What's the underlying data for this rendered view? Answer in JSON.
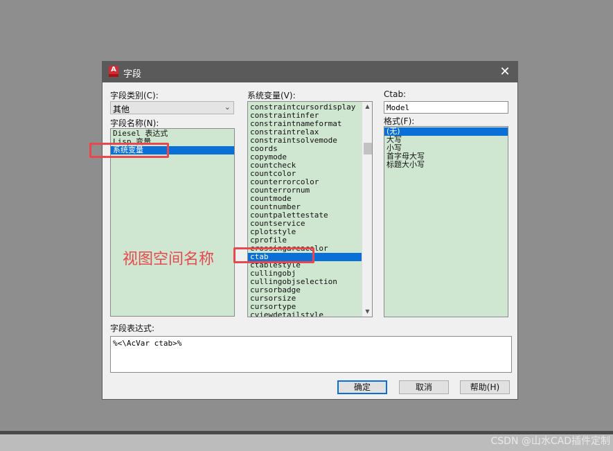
{
  "dialog": {
    "title": "字段",
    "app_icon_letter": "A",
    "close_glyph": "✕",
    "field_category_label": "字段类别(C):",
    "field_category_value": "其他",
    "field_names_label": "字段名称(N):",
    "field_names": [
      {
        "label": "Diesel 表达式",
        "selected": false
      },
      {
        "label": "Lisp 变量",
        "selected": false
      },
      {
        "label": "系统变量",
        "selected": true
      }
    ],
    "system_vars_label": "系统变量(V):",
    "system_vars": [
      {
        "label": "constraintcursordisplay",
        "selected": false
      },
      {
        "label": "constraintinfer",
        "selected": false
      },
      {
        "label": "constraintnameformat",
        "selected": false
      },
      {
        "label": "constraintrelax",
        "selected": false
      },
      {
        "label": "constraintsolvemode",
        "selected": false
      },
      {
        "label": "coords",
        "selected": false
      },
      {
        "label": "copymode",
        "selected": false
      },
      {
        "label": "countcheck",
        "selected": false
      },
      {
        "label": "countcolor",
        "selected": false
      },
      {
        "label": "counterrorcolor",
        "selected": false
      },
      {
        "label": "counterrornum",
        "selected": false
      },
      {
        "label": "countmode",
        "selected": false
      },
      {
        "label": "countnumber",
        "selected": false
      },
      {
        "label": "countpalettestate",
        "selected": false
      },
      {
        "label": "countservice",
        "selected": false
      },
      {
        "label": "cplotstyle",
        "selected": false
      },
      {
        "label": "cprofile",
        "selected": false
      },
      {
        "label": "crossingareacolor",
        "selected": false
      },
      {
        "label": "ctab",
        "selected": true
      },
      {
        "label": "ctablestyle",
        "selected": false
      },
      {
        "label": "cullingobj",
        "selected": false
      },
      {
        "label": "cullingobjselection",
        "selected": false
      },
      {
        "label": "cursorbadge",
        "selected": false
      },
      {
        "label": "cursorsize",
        "selected": false
      },
      {
        "label": "cursortype",
        "selected": false
      },
      {
        "label": "cviewdetailstyle",
        "selected": false
      }
    ],
    "ctab_label": "Ctab:",
    "ctab_value": "Model",
    "format_label": "格式(F):",
    "formats": [
      {
        "label": "(无)",
        "selected": true
      },
      {
        "label": "大写",
        "selected": false
      },
      {
        "label": "小写",
        "selected": false
      },
      {
        "label": "首字母大写",
        "selected": false
      },
      {
        "label": "标题大小写",
        "selected": false
      }
    ],
    "expression_label": "字段表达式:",
    "expression_value": "%<\\AcVar ctab>%",
    "ok_label": "确定",
    "cancel_label": "取消",
    "help_label": "帮助(H)"
  },
  "annotation": {
    "text": "视图空间名称"
  },
  "watermark": "CSDN @山水CAD插件定制",
  "colors": {
    "selection": "#0a6fd6",
    "list_bg": "#cfe6d0",
    "annotation_red": "#e8484d",
    "titlebar": "#5a5a5a"
  },
  "icons": {
    "close": "close-icon",
    "dropdown": "chevron-down-icon",
    "scroll_up": "scroll-up-arrow",
    "scroll_down": "scroll-down-arrow",
    "app": "autocad-app-icon"
  }
}
